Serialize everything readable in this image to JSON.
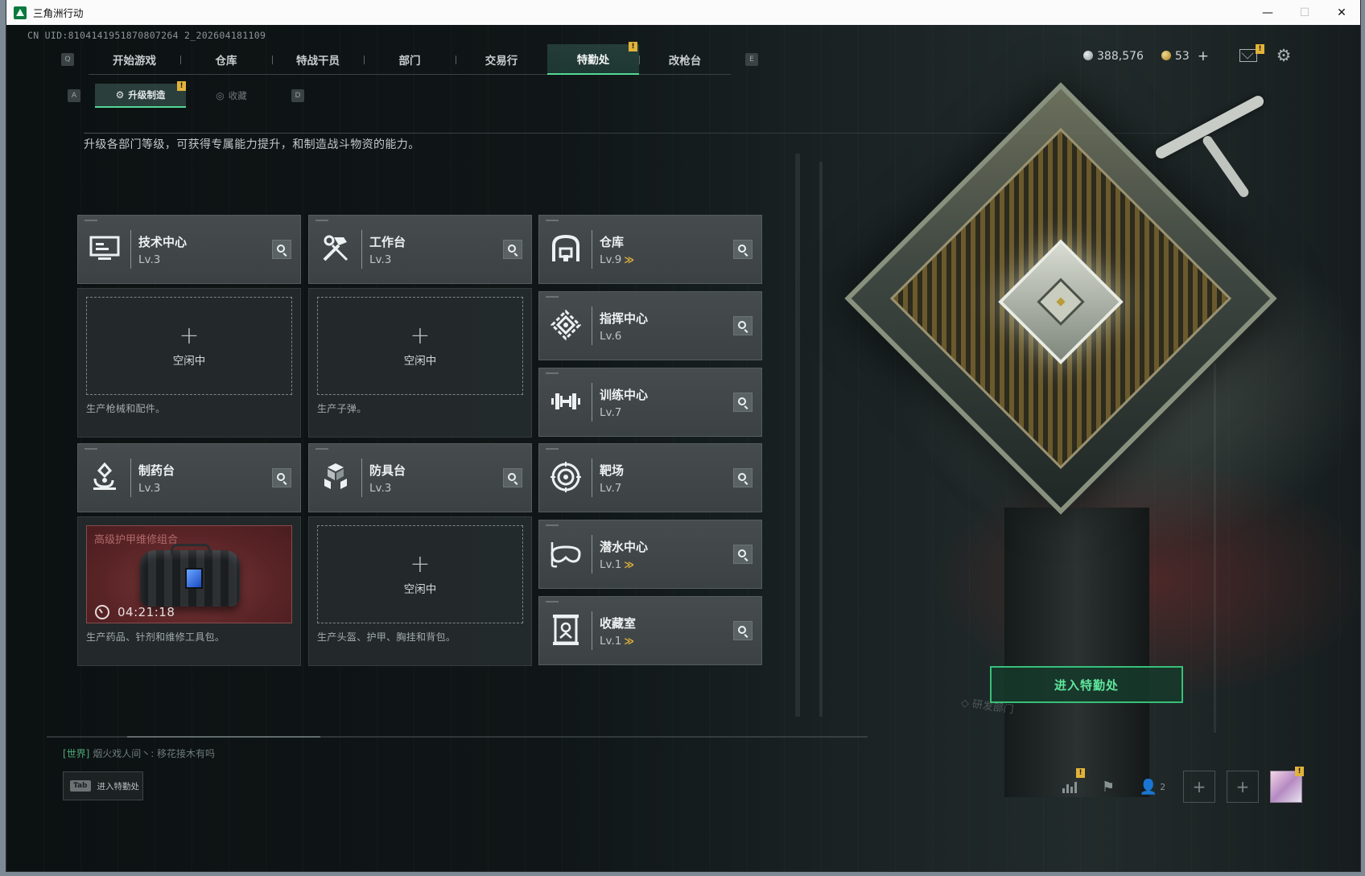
{
  "window": {
    "title": "三角洲行动",
    "controls": [
      "—",
      "☐",
      "✕"
    ]
  },
  "uid": "CN UID:8104141951870807264 2_202604181109",
  "nav": {
    "left_key": "Q",
    "right_key": "E",
    "tabs": [
      "开始游戏",
      "仓库",
      "特战干员",
      "部门",
      "交易行",
      "特勤处",
      "改枪台"
    ],
    "active_index": 5,
    "alert_badge": "!"
  },
  "currency": {
    "silver": "388,576",
    "gold": "53",
    "plus": "+"
  },
  "subnav": {
    "left_key": "A",
    "right_key": "D",
    "tabs": [
      "升级制造",
      "收藏"
    ],
    "active_index": 0,
    "alert_badge": "!"
  },
  "description": "升级各部门等级，可获得专属能力提升，和制造战斗物资的能力。",
  "departments": [
    {
      "name": "技术中心",
      "level": "Lv.3",
      "upgradable": false,
      "icon": "computer-icon"
    },
    {
      "name": "工作台",
      "level": "Lv.3",
      "upgradable": false,
      "icon": "tools-icon"
    },
    {
      "name": "仓库",
      "level": "Lv.9",
      "upgradable": true,
      "icon": "warehouse-icon"
    },
    {
      "name": "指挥中心",
      "level": "Lv.6",
      "upgradable": false,
      "icon": "command-icon"
    },
    {
      "name": "训练中心",
      "level": "Lv.7",
      "upgradable": false,
      "icon": "dumbbell-icon"
    },
    {
      "name": "制药台",
      "level": "Lv.3",
      "upgradable": false,
      "icon": "microscope-icon"
    },
    {
      "name": "防具台",
      "level": "Lv.3",
      "upgradable": false,
      "icon": "armor-icon"
    },
    {
      "name": "靶场",
      "level": "Lv.7",
      "upgradable": false,
      "icon": "target-icon"
    },
    {
      "name": "潜水中心",
      "level": "Lv.1",
      "upgradable": true,
      "icon": "diving-mask-icon"
    },
    {
      "name": "收藏室",
      "level": "Lv.1",
      "upgradable": true,
      "icon": "collection-icon"
    }
  ],
  "upgrade_mark": "≫",
  "slots": {
    "idle_plus": "+",
    "idle_text": "空闲中",
    "tech_desc": "生产枪械和配件。",
    "workbench_desc": "生产子弹。",
    "pharmacy_desc": "生产药品、针剂和维修工具包。",
    "armor_desc": "生产头盔、护甲、胸挂和背包。",
    "pharmacy_crafting": {
      "item": "高级护甲维修组合",
      "timer": "04:21:18"
    }
  },
  "enter_button": "进入特勤处",
  "dept_watermark": "◇ 研发部门",
  "chat": {
    "channel": "[世界]",
    "message": "烟火戏人间丶: 移花接木有吗"
  },
  "tab_hint": {
    "key": "Tab",
    "label": "进入特勤处"
  },
  "bottom": {
    "friends_count": "2",
    "add": "+"
  },
  "colors": {
    "accent_green": "#54d895",
    "alert_yellow": "#e2b33a",
    "craft_red": "#5a2426"
  }
}
